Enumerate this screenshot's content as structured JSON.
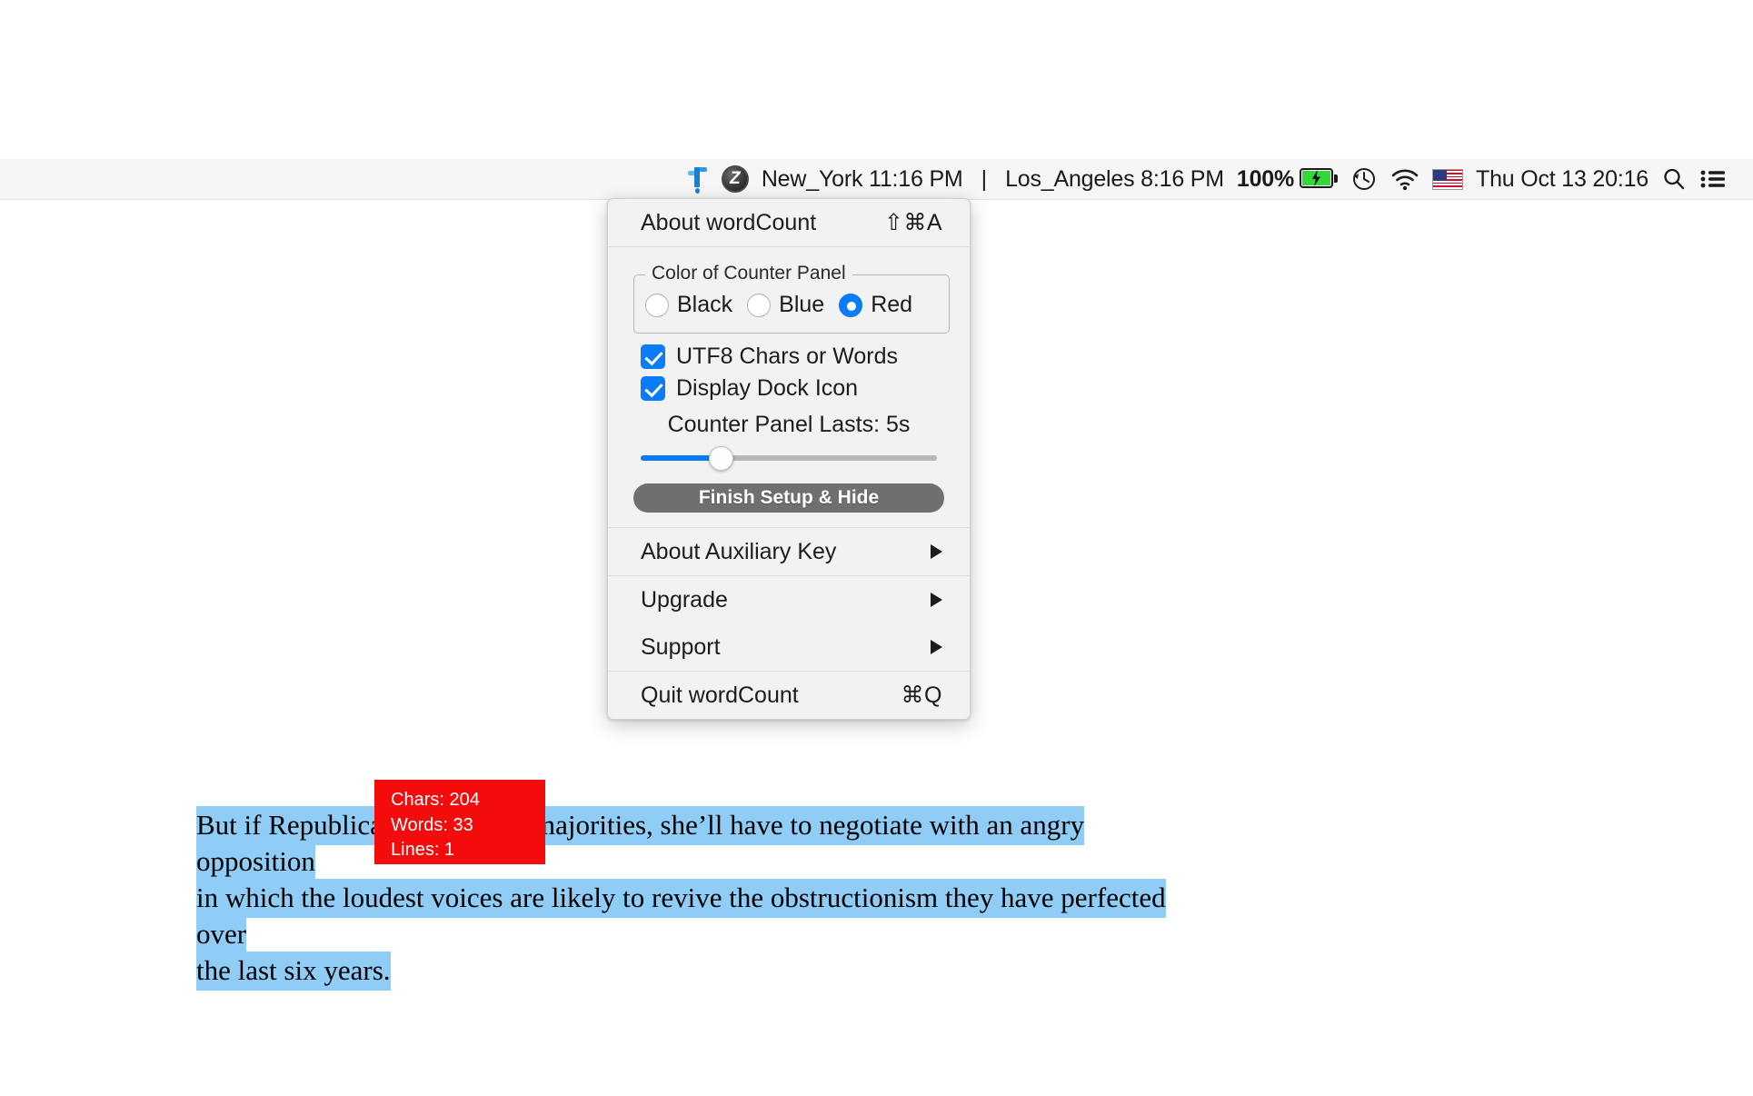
{
  "menubar": {
    "app_icon": "faucet-icon",
    "secondary_icon": "z-disc-icon",
    "clock_new_york": "New_York 11:16 PM",
    "clock_separator": "|",
    "clock_los_angeles": "Los_Angeles 8:16 PM",
    "battery_percent": "100%",
    "battery_state_icon": "battery-charging-icon",
    "time_machine_icon": "clock-history-icon",
    "wifi_icon": "wifi-icon",
    "input_source_icon": "us-flag-icon",
    "datetime": "Thu Oct 13  20:16",
    "search_icon": "search-icon",
    "control_center_icon": "control-center-icon"
  },
  "menu": {
    "about": {
      "label": "About wordCount",
      "shortcut": "⇧⌘A"
    },
    "color_group": {
      "title": "Color of Counter Panel",
      "options": [
        {
          "label": "Black",
          "selected": false
        },
        {
          "label": "Blue",
          "selected": false
        },
        {
          "label": "Red",
          "selected": true
        }
      ],
      "selected_value": "Red"
    },
    "checkboxes": [
      {
        "label": "UTF8 Chars or Words",
        "checked": true
      },
      {
        "label": "Display Dock Icon",
        "checked": true
      }
    ],
    "slider": {
      "label": "Counter Panel Lasts:",
      "value": "5s",
      "percent": 27
    },
    "finish_button": "Finish Setup & Hide",
    "auxiliary_key": "About Auxiliary Key",
    "upgrade": "Upgrade",
    "support": "Support",
    "quit": {
      "label": "Quit wordCount",
      "shortcut": "⌘Q"
    },
    "submenu_arrow_icon": "triangle-right-icon"
  },
  "counter_panel": {
    "color": "#f40c0c",
    "chars": "Chars: 204",
    "words": "Words: 33",
    "lines": "Lines: 1"
  },
  "article": {
    "line1": "But if Republicans keep their majorities, she’ll have to negotiate with an angry opposition",
    "line2": "in which the loudest voices are likely to revive the obstructionism they have perfected over",
    "line3": "the last six years.",
    "selection_color": "#8fcdf6"
  }
}
